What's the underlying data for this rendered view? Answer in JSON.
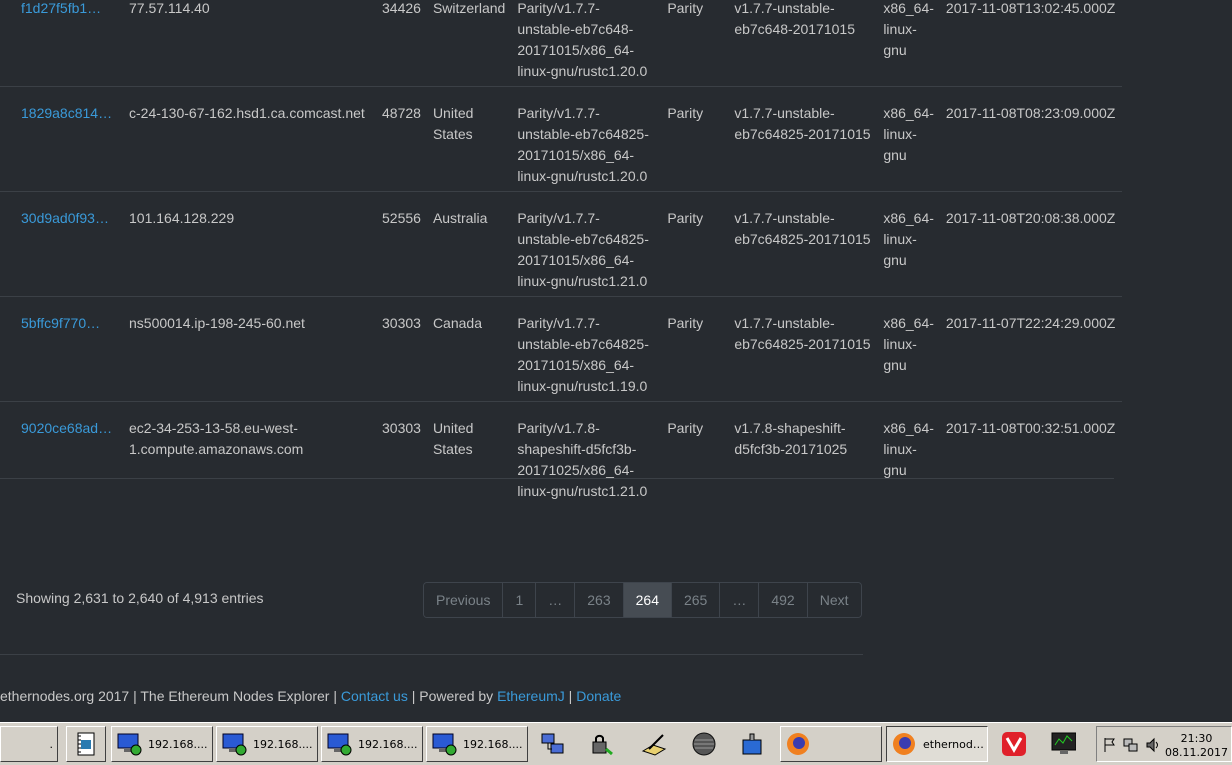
{
  "rows": [
    {
      "id": "f1d27f5fb1…",
      "host": "77.57.114.40",
      "port": "34426",
      "country": "Switzerland",
      "client": "Parity/v1.7.7-unstable-eb7c648-20171015/x86_64-linux-gnu/rustc1.20.0",
      "name": "Parity",
      "version": "v1.7.7-unstable-eb7c648-20171015",
      "os": "x86_64-linux-gnu",
      "date": "2017-11-08T13:02:45.000Z"
    },
    {
      "id": "1829a8c814…",
      "host": "c-24-130-67-162.hsd1.ca.comcast.net",
      "port": "48728",
      "country": "United States",
      "client": "Parity/v1.7.7-unstable-eb7c64825-20171015/x86_64-linux-gnu/rustc1.20.0",
      "name": "Parity",
      "version": "v1.7.7-unstable-eb7c64825-20171015",
      "os": "x86_64-linux-gnu",
      "date": "2017-11-08T08:23:09.000Z"
    },
    {
      "id": "30d9ad0f93…",
      "host": "101.164.128.229",
      "port": "52556",
      "country": "Australia",
      "client": "Parity/v1.7.7-unstable-eb7c64825-20171015/x86_64-linux-gnu/rustc1.21.0",
      "name": "Parity",
      "version": "v1.7.7-unstable-eb7c64825-20171015",
      "os": "x86_64-linux-gnu",
      "date": "2017-11-08T20:08:38.000Z"
    },
    {
      "id": "5bffc9f770…",
      "host": "ns500014.ip-198-245-60.net",
      "port": "30303",
      "country": "Canada",
      "client": "Parity/v1.7.7-unstable-eb7c64825-20171015/x86_64-linux-gnu/rustc1.19.0",
      "name": "Parity",
      "version": "v1.7.7-unstable-eb7c64825-20171015",
      "os": "x86_64-linux-gnu",
      "date": "2017-11-07T22:24:29.000Z"
    },
    {
      "id": "9020ce68ad…",
      "host": "ec2-34-253-13-58.eu-west-1.compute.amazonaws.com",
      "port": "30303",
      "country": "United States",
      "client": "Parity/v1.7.8-shapeshift-d5fcf3b-20171025/x86_64-linux-gnu/rustc1.21.0",
      "name": "Parity",
      "version": "v1.7.8-shapeshift-d5fcf3b-20171025",
      "os": "x86_64-linux-gnu",
      "date": "2017-11-08T00:32:51.000Z"
    }
  ],
  "info": "Showing 2,631 to 2,640 of 4,913 entries",
  "pagination": [
    "Previous",
    "1",
    "…",
    "263",
    "264",
    "265",
    "…",
    "492",
    "Next"
  ],
  "pagination_active": "264",
  "footer": {
    "prefix": "ethernodes.org 2017 | The Ethereum Nodes Explorer | ",
    "contact": "Contact us",
    "powered": " | Powered by ",
    "ethereumj": "EthereumJ",
    "sep": " | ",
    "donate": "Donate"
  },
  "taskbar": {
    "start_label": ".",
    "rdp_label": "192.168....",
    "firefox_label": "ethernod…",
    "clock_time": "21:30",
    "clock_date": "08.11.2017"
  },
  "colors": {
    "background": "#272b30",
    "link": "#3a9ad9",
    "active_page": "#464c53",
    "taskbar": "#d4d0c8"
  }
}
